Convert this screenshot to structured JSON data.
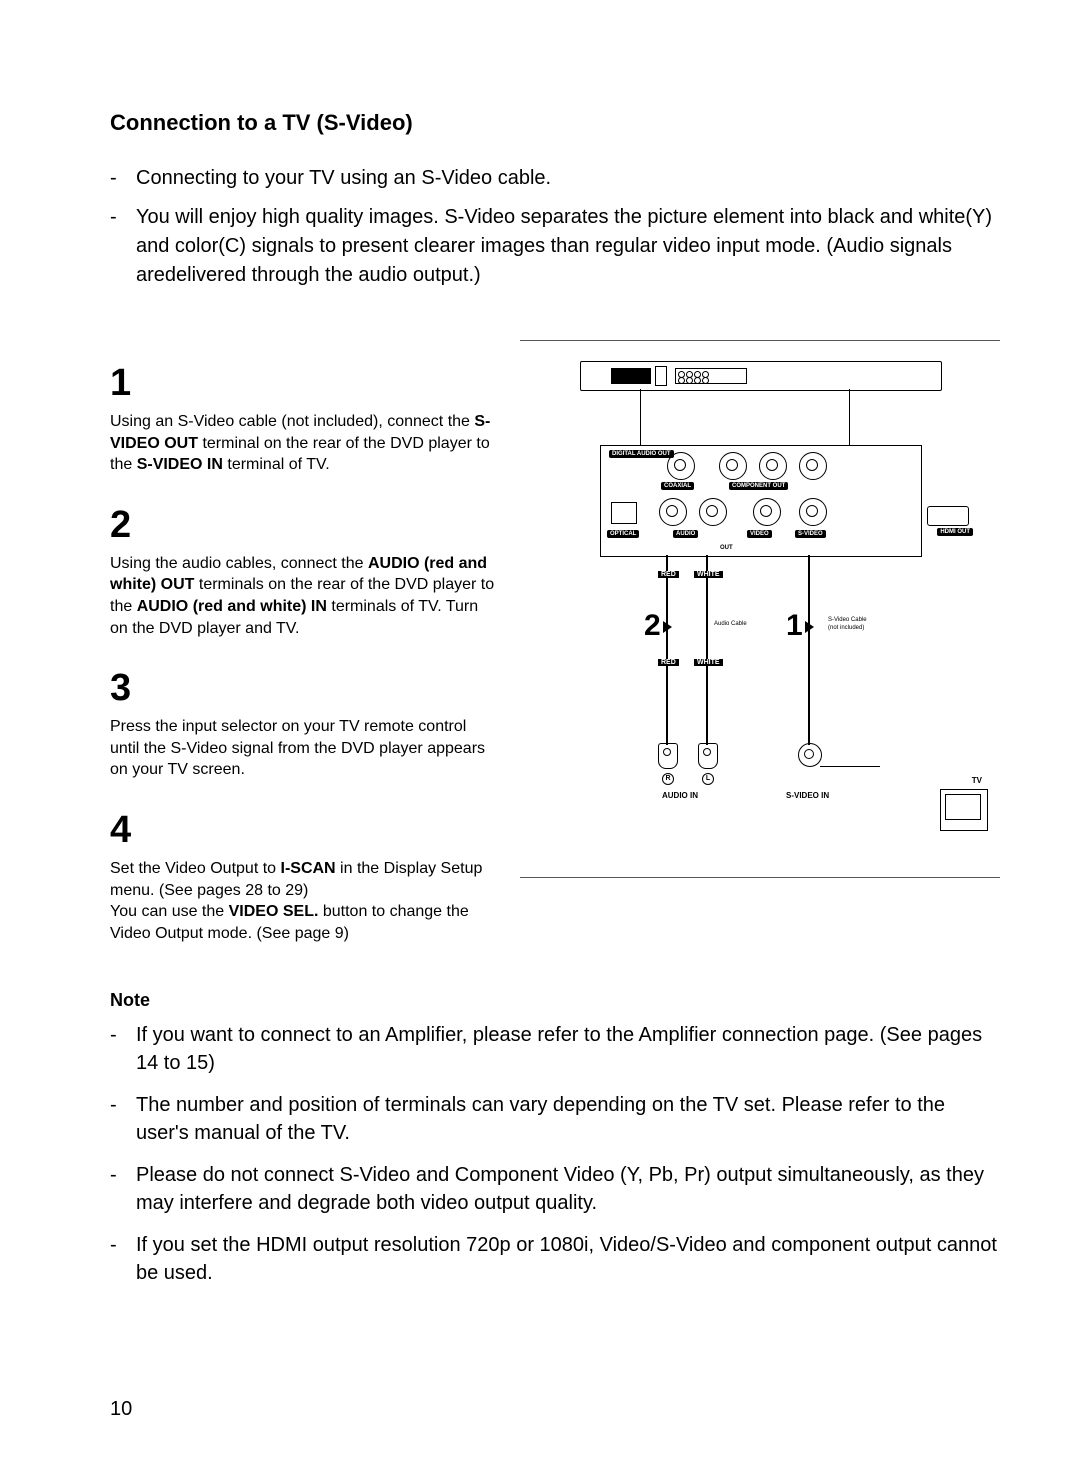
{
  "title": "Connection to a TV (S-Video)",
  "intro": [
    "Connecting to your TV using an S-Video cable.",
    "You will enjoy high quality images. S-Video separates the picture element into black and white(Y) and color(C) signals to present clearer images than regular video input mode. (Audio signals aredelivered through the audio output.)"
  ],
  "steps": {
    "s1": {
      "num": "1",
      "text_pre": "Using an S-Video cable (not included), connect the ",
      "bold1": "S-VIDEO OUT",
      "text_mid": " terminal on the rear of the DVD player to the ",
      "bold2": "S-VIDEO IN",
      "text_post": " terminal of TV."
    },
    "s2": {
      "num": "2",
      "text_pre": "Using the audio cables, connect the ",
      "bold1": "AUDIO (red and white) OUT",
      "text_mid": " terminals on the rear of the DVD player to the ",
      "bold2": "AUDIO (red and white) IN",
      "text_post": " terminals of TV. Turn on the DVD player and TV."
    },
    "s3": {
      "num": "3",
      "text": "Press the input selector on your TV remote control until the S-Video signal from the DVD player appears on your TV screen."
    },
    "s4": {
      "num": "4",
      "line1_pre": "Set the Video Output to ",
      "line1_bold": "I-SCAN",
      "line1_post": " in the Display Setup menu. (See pages 28 to 29)",
      "line2_pre": "You can use the ",
      "line2_bold": "VIDEO SEL.",
      "line2_post": " button to change the Video Output mode. (See page 9)"
    }
  },
  "diagram": {
    "labels": {
      "digital_audio_out": "DIGITAL AUDIO OUT",
      "coaxial": "COAXIAL",
      "component_out": "COMPONENT OUT",
      "optical": "OPTICAL",
      "audio": "AUDIO",
      "video": "VIDEO",
      "out": "OUT",
      "s_video": "S-VIDEO",
      "hdmi_out": "HDMI OUT",
      "red": "RED",
      "white": "WHITE",
      "audio_cable": "Audio Cable",
      "svideo_cable": "S-Video Cable",
      "not_included": "(not included)",
      "r": "R",
      "l": "L",
      "audio_in": "AUDIO IN",
      "s_video_in": "S-VIDEO IN",
      "tv": "TV",
      "marker1": "1",
      "marker2": "2"
    }
  },
  "note_heading": "Note",
  "notes": [
    "If you want to connect to an Amplifier, please refer to the Amplifier connection page. (See pages 14 to 15)",
    "The number and position of terminals can vary depending on the TV set. Please refer to the user's manual of the TV.",
    "Please do not connect  S-Video and Component Video (Y, Pb, Pr) output simultaneously, as they may interfere and degrade both video output quality.",
    "If you set the HDMI output resolution 720p or 1080i, Video/S-Video and component output cannot be used."
  ],
  "page_number": "10"
}
